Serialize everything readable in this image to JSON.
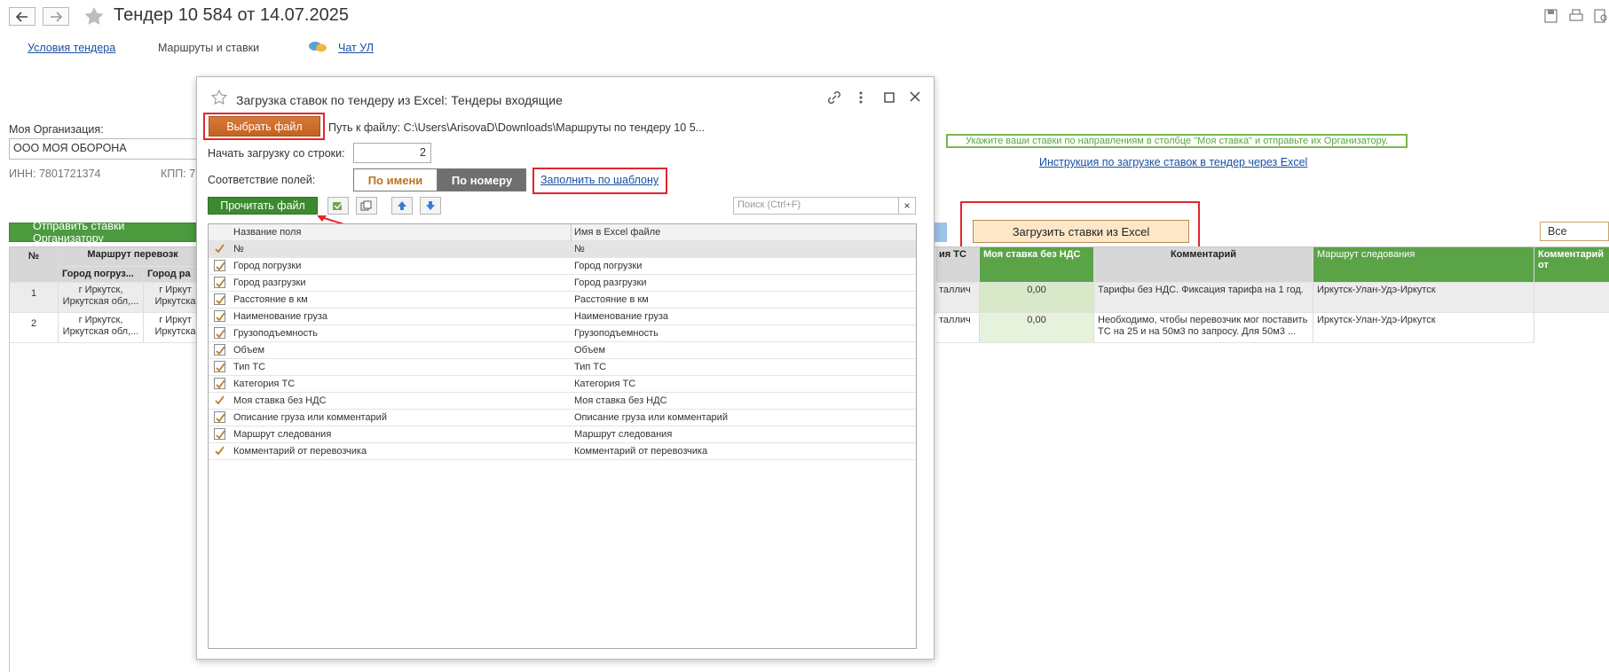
{
  "window": {
    "title": "Тендер 10 584 от 14.07.2025",
    "tabs": [
      "Условия тендера",
      "Маршруты и ставки",
      "Чат УЛ"
    ]
  },
  "org": {
    "label": "Моя Организация:",
    "name": "ООО МОЯ ОБОРОНА",
    "inn": "ИНН: 7801721374",
    "kpp": "КПП: 7"
  },
  "actions": {
    "send_label": "Отправить ставки Организатору",
    "load_excel_label": "Загрузить ставки из Excel",
    "all_rates_label": "Все ставки",
    "hint": "Укажите ваши ставки по направлениям в столбце \"Моя ставка\" и отправьте их Организатору.",
    "instruction_link": "Инструкция по загрузке ставок в тендер через Excel"
  },
  "grid": {
    "headers": {
      "num": "№",
      "route": "Маршрут перевозк",
      "city_load": "Город погруз...",
      "city_unload": "Город ра",
      "ts_type": "ия ТС",
      "my_rate": "Моя ставка без НДС",
      "comment": "Комментарий",
      "route_follow": "Маршрут следования",
      "carrier_comment": "Комментарий от"
    },
    "rows": [
      {
        "num": "1",
        "load": "г Иркутск,",
        "load2": "Иркутская обл,...",
        "unload": "г Иркут",
        "unload2": "Иркутска",
        "ts": "таллич",
        "rate": "0,00",
        "comment": "Тарифы без НДС. Фиксация тарифа на 1 год.",
        "comment2": "",
        "route": "Иркутск-Улан-Удэ-Иркутск"
      },
      {
        "num": "2",
        "load": "г Иркутск,",
        "load2": "Иркутская обл,...",
        "unload": "г Иркут",
        "unload2": "Иркутска",
        "ts": "таллич",
        "rate": "0,00",
        "comment": "Необходимо, чтобы перевозчик мог поставить",
        "comment2": "ТС на 25 и на 50м3 по запросу. Для 50м3 ...",
        "route": "Иркутск-Улан-Удэ-Иркутск"
      }
    ]
  },
  "modal": {
    "title": "Загрузка ставок по тендеру из Excel: Тендеры входящие",
    "choose_file": "Выбрать файл",
    "path_label": "Путь к файлу:",
    "path_value": "C:\\Users\\ArisovaD\\Downloads\\Маршруты по тендеру 10 5...",
    "start_row_label": "Начать загрузку со строки:",
    "start_row_value": "2",
    "match_label": "Соответствие полей:",
    "by_name": "По имени",
    "by_number": "По номеру",
    "fill_template": "Заполнить по шаблону",
    "read_file": "Прочитать файл",
    "search_placeholder": "Поиск (Ctrl+F)",
    "search_clear": "×",
    "col_field": "Название поля",
    "col_excel": "Имя в Excel файле",
    "rows": [
      {
        "field": "№",
        "excel": "№",
        "checked": true,
        "box": false
      },
      {
        "field": "Город погрузки",
        "excel": "Город погрузки",
        "checked": true,
        "box": true
      },
      {
        "field": "Город разгрузки",
        "excel": "Город разгрузки",
        "checked": true,
        "box": true
      },
      {
        "field": "Расстояние в км",
        "excel": "Расстояние в км",
        "checked": true,
        "box": true
      },
      {
        "field": "Наименование груза",
        "excel": "Наименование груза",
        "checked": true,
        "box": true
      },
      {
        "field": "Грузоподъемность",
        "excel": "Грузоподъемность",
        "checked": true,
        "box": true
      },
      {
        "field": "Объем",
        "excel": "Объем",
        "checked": true,
        "box": true
      },
      {
        "field": "Тип ТС",
        "excel": "Тип ТС",
        "checked": true,
        "box": true
      },
      {
        "field": "Категория ТС",
        "excel": "Категория ТС",
        "checked": true,
        "box": true
      },
      {
        "field": "Моя ставка без НДС",
        "excel": "Моя ставка без НДС",
        "checked": true,
        "box": false
      },
      {
        "field": "Описание груза или комментарий",
        "excel": "Описание груза или комментарий",
        "checked": true,
        "box": true
      },
      {
        "field": "Маршрут следования",
        "excel": "Маршрут следования",
        "checked": true,
        "box": true
      },
      {
        "field": "Комментарий от перевозчика",
        "excel": "Комментарий от перевозчика",
        "checked": true,
        "box": false
      }
    ]
  },
  "colors": {
    "accent_green": "#4b9a3e",
    "header_green": "#5aa447",
    "highlight_red": "#e3252d",
    "orange_button": "#c3621f",
    "link_blue": "#1a4fa3"
  }
}
